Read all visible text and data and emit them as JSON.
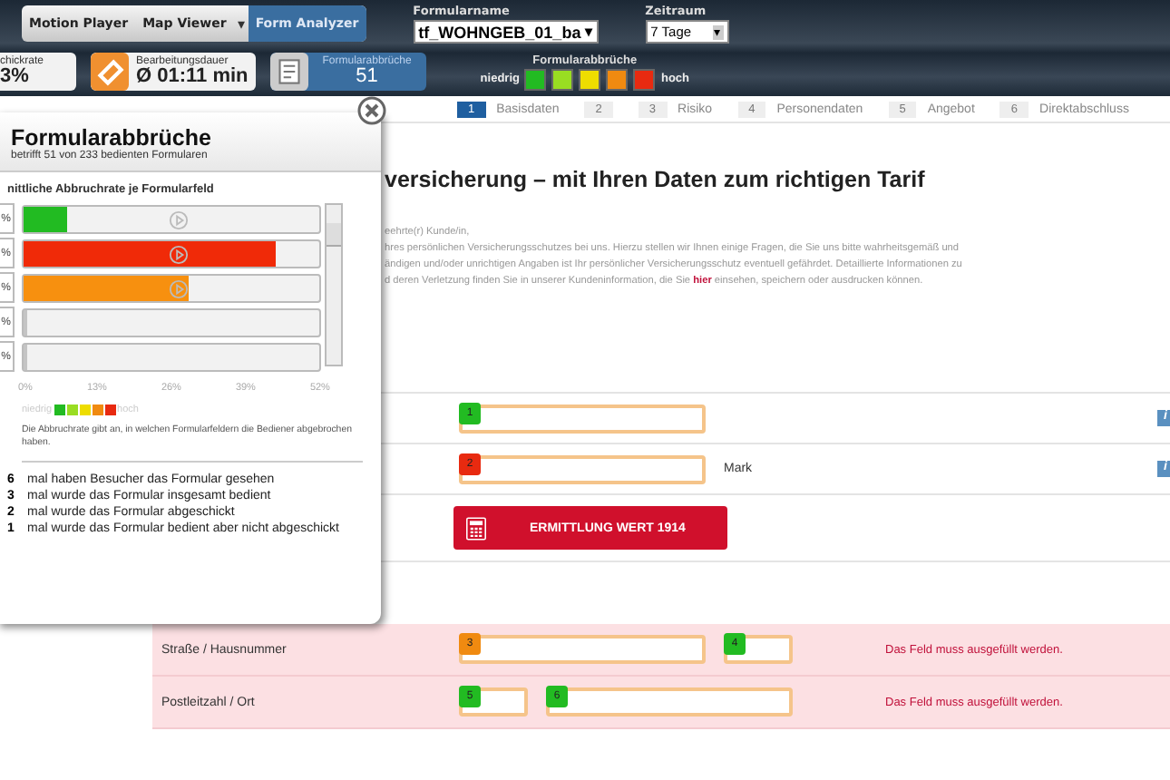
{
  "toolbar": {
    "views_caret": "▾",
    "views": [
      {
        "label": "Motion Player",
        "selected": false
      },
      {
        "label": "Map Viewer",
        "selected": false
      },
      {
        "label": "Form Analyzer",
        "selected": true
      }
    ],
    "form_name": {
      "label": "Formularname",
      "value": "tf_WOHNGEB_01_ba",
      "arrow": "▾"
    },
    "period": {
      "label": "Zeitraum",
      "value": "7 Tage",
      "arrow": "▾"
    },
    "stats": [
      {
        "kind": "plain",
        "label": "chickrate",
        "value": "3%",
        "selected": false
      },
      {
        "kind": "duration",
        "label": "Bearbeitungsdauer",
        "value": "Ø 01:11 min",
        "selected": false
      },
      {
        "kind": "doc",
        "label": "Formularabbrüche",
        "value": "51",
        "selected": true
      }
    ],
    "legend": {
      "title": "Formularabbrüche",
      "low": "niedrig",
      "high": "hoch",
      "swatches": [
        {
          "color": "#22bb22"
        },
        {
          "color": "#99dd22"
        },
        {
          "color": "#eedd00"
        },
        {
          "color": "#f08a10"
        },
        {
          "color": "#e82a10"
        }
      ]
    }
  },
  "steps": [
    {
      "number": "1",
      "label": "Basisdaten",
      "selected": true
    },
    {
      "number": "2",
      "selected": false
    },
    {
      "number": "3",
      "label": "Risiko",
      "selected": false
    },
    {
      "number": "4",
      "label": "Personendaten",
      "selected": false
    },
    {
      "number": "5",
      "label": "Angebot",
      "selected": false
    },
    {
      "number": "6",
      "label": "Direktabschluss",
      "selected": false
    }
  ],
  "page": {
    "heading": "versicherung – mit Ihren Daten zum richtigen Tarif",
    "paragraph": [
      "eehrte(r) Kunde/in,",
      "hres persönlichen Versicherungsschutzes bei uns. Hierzu stellen wir Ihnen einige Fragen, die Sie uns bitte wahrheitsgemäß und",
      "ändigen und/oder unrichtigen Angaben ist Ihr persönlicher Versicherungsschutz eventuell gefährdet. Detaillierte Informationen zu",
      "d deren Verletzung finden Sie in unserer Kundeninformation, die Sie **hier** einsehen, speichern oder ausdrucken können."
    ],
    "rows": [
      {
        "fields": [
          {
            "badge": "1",
            "color": "#22bb22",
            "kind": "wide"
          }
        ],
        "info": "i"
      },
      {
        "fields": [
          {
            "badge": "2",
            "color": "#e82a10",
            "kind": "wide"
          }
        ],
        "unit": "Mark",
        "info": "i"
      },
      {
        "label": "Straße / Hausnummer",
        "error": "Das Feld muss ausgefüllt werden.",
        "fields": [
          {
            "badge": "3",
            "color": "#f08a10",
            "kind": "wide"
          },
          {
            "badge": "4",
            "color": "#22bb22",
            "kind": "small"
          }
        ]
      },
      {
        "label": "Postleitzahl / Ort",
        "error": "Das Feld muss ausgefüllt werden.",
        "fields": [
          {
            "badge": "5",
            "color": "#22bb22",
            "kind": "small"
          },
          {
            "badge": "6",
            "color": "#22bb22",
            "kind": "wide"
          }
        ]
      }
    ],
    "button": "ERMITTLUNG WERT 1914"
  },
  "popup": {
    "title": "Formularabbrüche",
    "subtitle": "betrifft 51 von 233 bedienten Formularen",
    "section": "nittliche Abbruchrate je Formularfeld",
    "bars": [
      {
        "label": "%",
        "level": 0.15,
        "color": "#22bb22",
        "play": true
      },
      {
        "label": "%",
        "level": 0.85,
        "color": "#f02a08",
        "play": true
      },
      {
        "label": "%",
        "level": 0.56,
        "color": "#f7900f",
        "play": true
      },
      {
        "label": "%",
        "level": 0,
        "play": false
      },
      {
        "label": "%",
        "level": 0,
        "play": false
      }
    ],
    "ticks": [
      "0%",
      "13%",
      "26%",
      "39%",
      "52%"
    ],
    "legend": {
      "low": "niedrig",
      "high": "hoch"
    },
    "note": "Die Abbruchrate gibt an, in welchen Formularfeldern die Bediener abgebrochen haben.",
    "counts": [
      {
        "number": "6",
        "text": "mal haben Besucher das Formular gesehen"
      },
      {
        "number": "3",
        "text": "mal wurde das Formular insgesamt bedient"
      },
      {
        "number": "2",
        "text": "mal wurde das Formular abgeschickt"
      },
      {
        "number": "1",
        "text": "mal wurde das Formular bedient aber nicht abgeschickt"
      }
    ]
  }
}
